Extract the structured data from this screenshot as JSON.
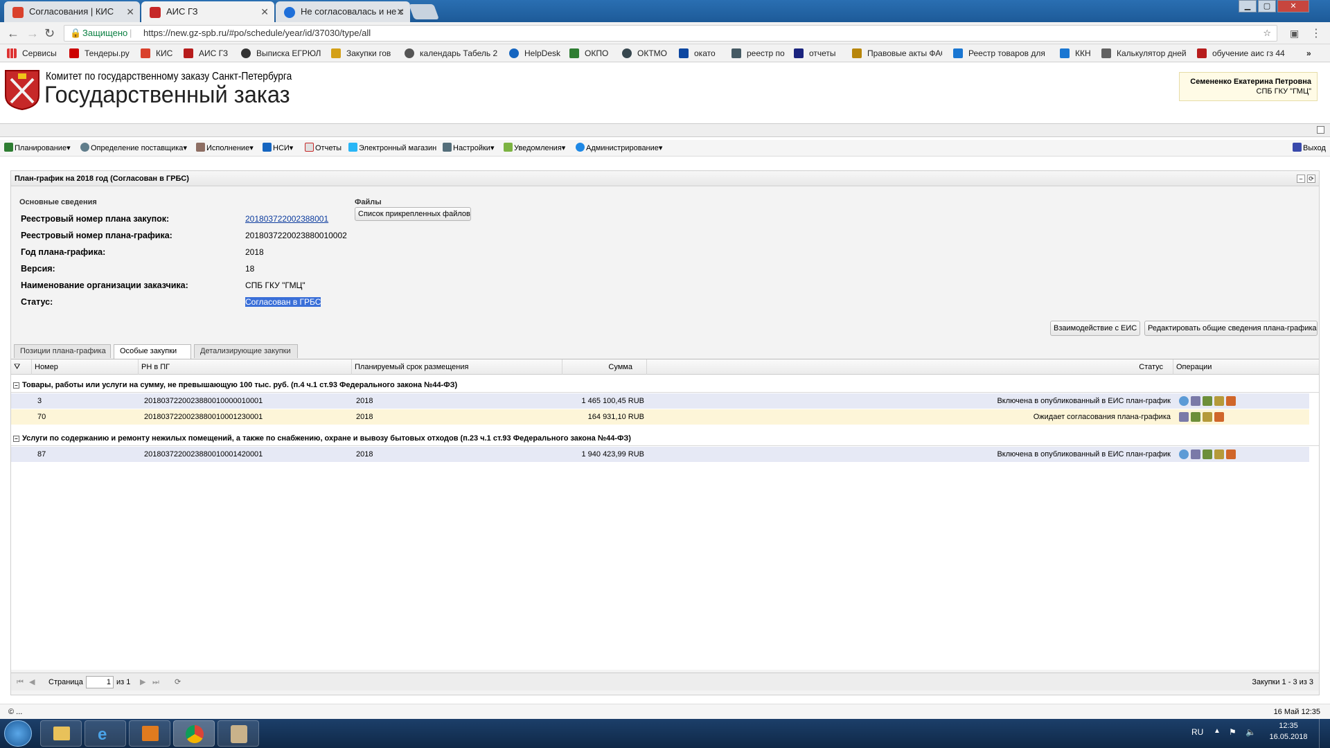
{
  "browser": {
    "tabs": [
      {
        "title": "Согласования | КИС",
        "color": "#d9412c"
      },
      {
        "title": "АИС ГЗ",
        "color": "#c62828"
      },
      {
        "title": "Не согласовалась и не с",
        "color": "#1e6fd9"
      }
    ],
    "secure_label": "Защищено",
    "url": "https://new.gz-spb.ru/#po/schedule/year/id/37030/type/all",
    "bookmarks": [
      "Сервисы",
      "Тендеры.ру",
      "КИС",
      "АИС ГЗ",
      "Выписка ЕГРЮЛ",
      "Закупки гов",
      "календарь Табель 2",
      "HelpDesk",
      "ОКПО",
      "ОКТМО",
      "окато",
      "реестр по",
      "отчеты",
      "Правовые акты ФАС",
      "Реестр товаров для",
      "ККН",
      "Калькулятор дней",
      "обучение аис гз 44"
    ]
  },
  "header": {
    "org_line": "Комитет по государственному заказу Санкт-Петербурга",
    "app_title": "Государственный заказ",
    "user_name": "Семененко Екатерина Петровна",
    "user_org": "СПБ ГКУ \"ГМЦ\""
  },
  "menu": {
    "items": [
      "Планирование",
      "Определение поставщика",
      "Исполнение",
      "НСИ",
      "Отчеты",
      "Электронный магазин",
      "Настройки",
      "Уведомления",
      "Администрирование"
    ],
    "logout": "Выход"
  },
  "panel": {
    "title": "План-график на 2018 год (Согласован в ГРБС)",
    "section_main": "Основные сведения",
    "section_files": "Файлы",
    "files_button": "Список прикрепленных файлов",
    "fields": [
      {
        "label": "Реестровый номер плана закупок:",
        "value": "201803722002388001"
      },
      {
        "label": "Реестровый номер плана-графика:",
        "value": "201803722002388001000­2"
      },
      {
        "label": "Год плана-графика:",
        "value": "2018"
      },
      {
        "label": "Версия:",
        "value": "18"
      },
      {
        "label": "Наименование организации заказчика:",
        "value": "СПБ ГКУ \"ГМЦ\""
      },
      {
        "label": "Статус:",
        "value": "Согласован в ГРБС"
      }
    ],
    "btn_eis": "Взаимодействие с ЕИС",
    "btn_edit": "Редактировать общие сведения плана-графика",
    "tabs": [
      "Позиции плана-графика",
      "Особые закупки",
      "Детализирующие закупки"
    ]
  },
  "grid": {
    "columns": [
      "Номер",
      "РН в ПГ",
      "Планируемый срок размещения",
      "Сумма",
      "Статус",
      "Операции"
    ],
    "groups": [
      {
        "title": "Товары, работы или услуги на сумму, не превышающую 100 тыс. руб. (п.4 ч.1 ст.93 Федерального закона №44-ФЗ)",
        "rows": [
          {
            "num": "3",
            "rn": "2018037220023880010000010001",
            "term": "2018",
            "sum": "1 465 100,45 RUB",
            "status": "Включена в опубликованный в ЕИС план-график"
          },
          {
            "num": "70",
            "rn": "2018037220023880010001230001",
            "term": "2018",
            "sum": "164 931,10 RUB",
            "status": "Ожидает согласования плана-графика"
          }
        ]
      },
      {
        "title": "Услуги по содержанию и ремонту нежилых помещений, а также по снабжению, охране и вывозу бытовых отходов (п.23 ч.1 ст.93 Федерального закона №44-ФЗ)",
        "rows": [
          {
            "num": "87",
            "rn": "2018037220023880010001420001",
            "term": "2018",
            "sum": "1 940 423,99 RUB",
            "status": "Включена в опубликованный в ЕИС план-график"
          }
        ]
      }
    ]
  },
  "pager": {
    "page_label": "Страница",
    "page_value": "1",
    "of_label": "из 1",
    "summary": "Закупки 1 - 3 из 3"
  },
  "statusbar": {
    "left": "© ...",
    "right": "16 Май 12:35"
  },
  "taskbar": {
    "lang": "RU",
    "time": "12:35",
    "date": "16.05.2018"
  }
}
